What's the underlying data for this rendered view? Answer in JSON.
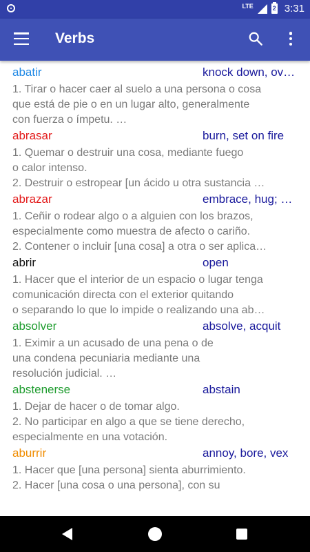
{
  "status_bar": {
    "network": "LTE",
    "battery_level": "2",
    "time": "3:31"
  },
  "app_bar": {
    "title": "Verbs",
    "icons": [
      "menu-icon",
      "search-icon",
      "more-vert-icon"
    ]
  },
  "entries": [
    {
      "word": "abatir",
      "color": "#1e88e5",
      "translation": "knock down, ov…",
      "lines": [
        "1. Tirar o hacer caer al suelo a una persona o cosa",
        "que está de pie o en un lugar alto, generalmente",
        "con fuerza o ímpetu. …"
      ]
    },
    {
      "word": "abrasar",
      "color": "#e31b1b",
      "translation": "burn, set on fire",
      "lines": [
        "1. Quemar o destruir una cosa, mediante fuego",
        "o calor intenso.",
        "2. Destruir o estropear [un ácido u otra sustancia …"
      ]
    },
    {
      "word": "abrazar",
      "color": "#e31b1b",
      "translation": "embrace, hug; …",
      "lines": [
        "1. Ceñir o rodear algo o a alguien con los brazos,",
        "especialmente como muestra de afecto o cariño.",
        "2. Contener o incluir [una cosa] a otra o ser aplica…"
      ]
    },
    {
      "word": "abrir",
      "color": "#111111",
      "translation": "open",
      "lines": [
        "1. Hacer que el interior de un espacio o lugar tenga",
        "comunicación directa con el exterior quitando",
        "o separando lo que lo impide o realizando una ab…"
      ]
    },
    {
      "word": "absolver",
      "color": "#1e9c2e",
      "translation": "absolve, acquit",
      "lines": [
        "1. Eximir a un acusado de una pena o de",
        "una condena pecuniaria mediante una",
        "resolución judicial. …"
      ]
    },
    {
      "word": "abstenerse",
      "color": "#1e9c2e",
      "translation": "abstain",
      "lines": [
        "1. Dejar de hacer o de tomar algo.",
        "2. No participar en algo a que se tiene derecho,",
        "especialmente en una votación."
      ]
    },
    {
      "word": "aburrir",
      "color": "#f08c00",
      "translation": "annoy, bore, vex",
      "lines": [
        "1. Hacer que [una persona] sienta aburrimiento.",
        "2. Hacer [una cosa o una persona], con su",
        ""
      ]
    }
  ],
  "nav_bar": {
    "icons": [
      "back-icon",
      "home-icon",
      "recents-icon"
    ]
  }
}
